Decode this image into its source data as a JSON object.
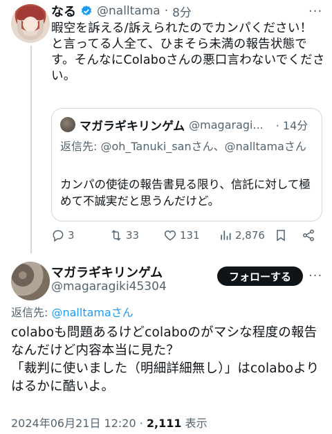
{
  "parent": {
    "name": "なる",
    "handle": "@nalltama",
    "separator": "·",
    "time": "8分",
    "more": "···",
    "text_lines": [
      "暇空を訴える/訴えられたのでカンパください！",
      "と言ってる人全て、ひまそら未満の報告状態です。そんなにColaboさんの悪口言わないでください。"
    ],
    "quote": {
      "name": "マガラギキリンゲム",
      "handle": "@magaragi...",
      "time": "· 14分",
      "reply_prefix": "返信先: ",
      "reply_to": "@oh_Tanuki_sanさん、@nalltamaさん",
      "text": "カンパの使徒の報告書見る限り、信託に対して極めて不誠実だと思うんだけど。"
    },
    "actions": {
      "replies": "3",
      "retweets": "33",
      "likes": "131",
      "views": "2,876"
    }
  },
  "main": {
    "name": "マガラギキリンゲム",
    "handle": "@magaragiki45304",
    "follow_label": "フォローする",
    "more": "···",
    "reply_prefix": "返信先: ",
    "reply_to": "@nalltamaさん",
    "text_lines": [
      "colaboも問題あるけどcolaboのがマシな程度の報告なんだけど内容本当に見た？",
      "「裁判に使いました（明細詳細無し）」はcolaboよりはるかに酷いよ。"
    ],
    "timestamp": "2024年06月21日 12:20",
    "meta_separator": " · ",
    "views_count": "2,111",
    "views_label": " 表示"
  },
  "colors": {
    "text": "#0f1419",
    "secondary": "#536471",
    "link": "#1d9bf0",
    "border": "#cfd9de",
    "verified": "#1d9bf0"
  }
}
